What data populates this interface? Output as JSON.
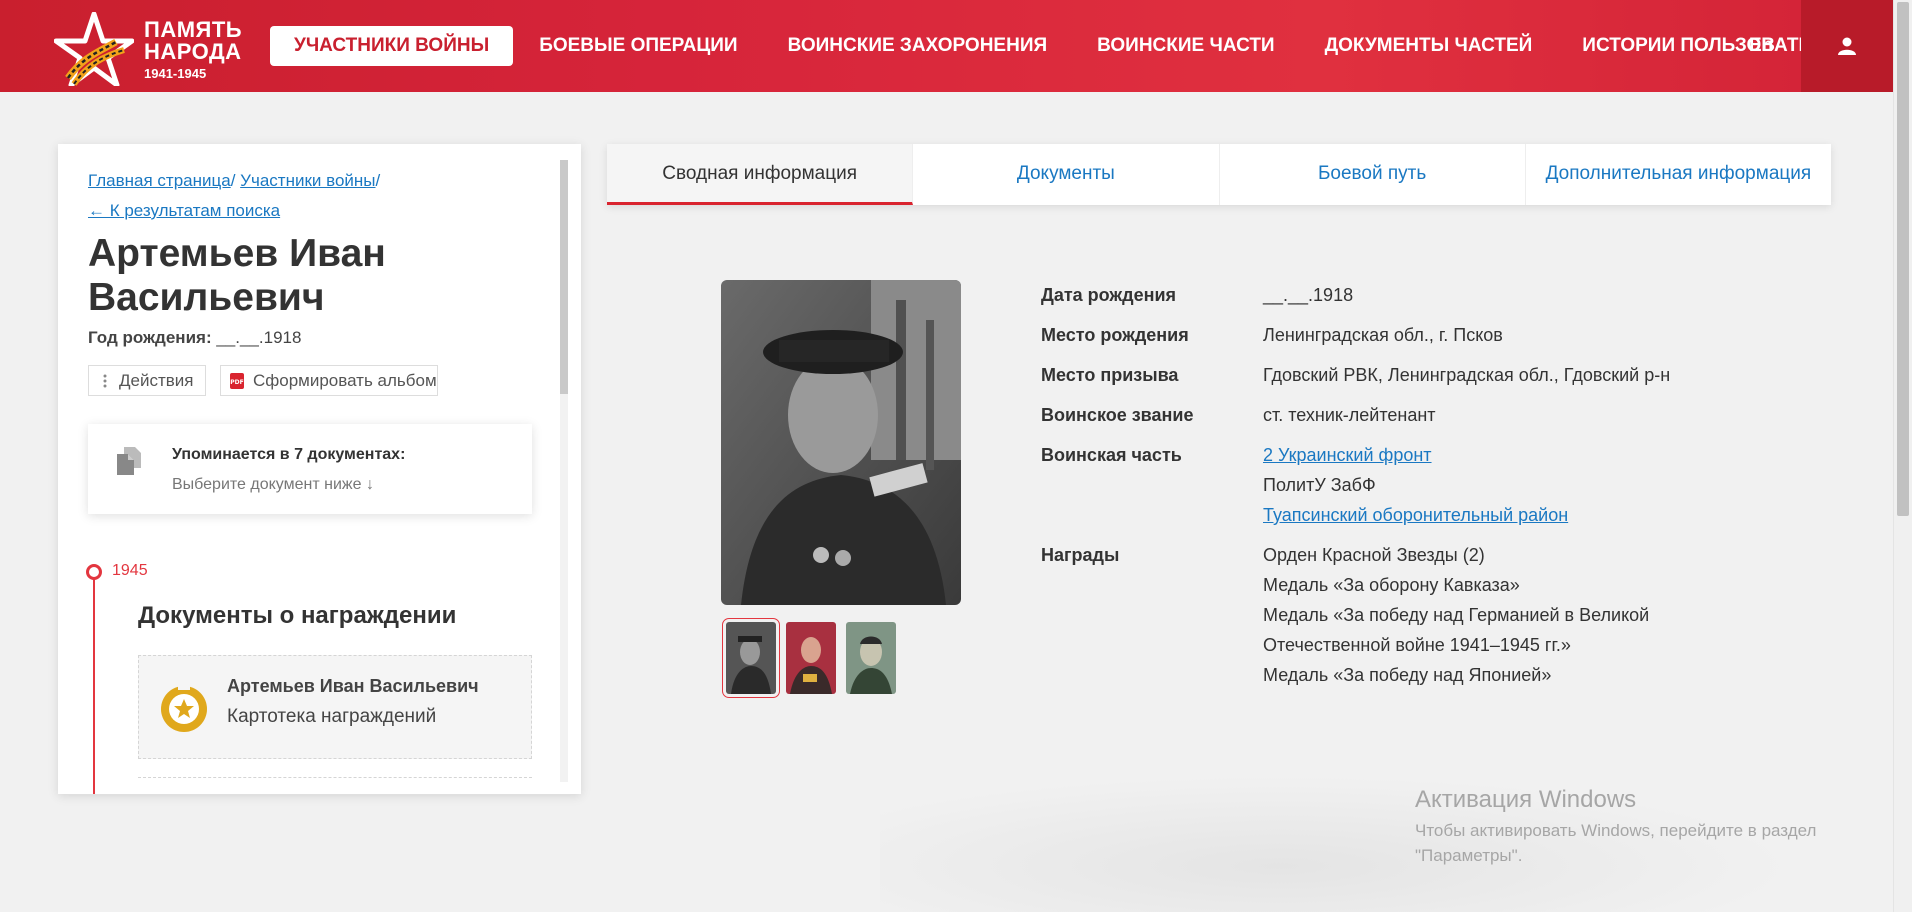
{
  "header": {
    "logo": {
      "line1": "ПАМЯТЬ",
      "line2": "НАРОДА",
      "years": "1941-1945"
    },
    "nav": [
      {
        "label": "УЧАСТНИКИ ВОЙНЫ",
        "active": true
      },
      {
        "label": "БОЕВЫЕ ОПЕРАЦИИ"
      },
      {
        "label": "ВОИНСКИЕ ЗАХОРОНЕНИЯ"
      },
      {
        "label": "ВОИНСКИЕ ЧАСТИ"
      },
      {
        "label": "ДОКУМЕНТЫ ЧАСТЕЙ"
      },
      {
        "label": "ИСТОРИИ ПОЛЬЗОВАТЕЛЕЙ"
      }
    ],
    "lang": "En",
    "user_icon": "user-icon",
    "colors": {
      "brand_red": "#d6243a",
      "link_blue": "#1a78c2"
    }
  },
  "sidebar": {
    "breadcrumb": {
      "home": "Главная страница",
      "participants": "Участники войны",
      "sep": "/",
      "back": "← К результатам поиска"
    },
    "name": "Артемьев Иван Васильевич",
    "birth_label": "Год рождения:",
    "birth_value": "__.__.1918",
    "actions_label": "Действия",
    "album_label": "Сформировать альбом",
    "mention_title": "Упоминается в 7 документах:",
    "mention_sub": "Выберите документ ниже",
    "mention_arrow": "↓",
    "timeline_year": "1945",
    "docs_heading": "Документы о награждении",
    "award_card": {
      "name": "Артемьев Иван Васильевич",
      "type": "Картотека награждений"
    }
  },
  "tabs": [
    {
      "label": "Сводная информация",
      "active": true
    },
    {
      "label": "Документы"
    },
    {
      "label": "Боевой путь"
    },
    {
      "label": "Дополнительная информация"
    }
  ],
  "info": {
    "birth_date": {
      "label": "Дата рождения",
      "value": "__.__.1918"
    },
    "birth_place": {
      "label": "Место рождения",
      "value": "Ленинградская обл., г. Псков"
    },
    "draft_place": {
      "label": "Место призыва",
      "value": "Гдовский РВК, Ленинградская обл., Гдовский р-н"
    },
    "rank": {
      "label": "Воинское звание",
      "value": "ст. техник-лейтенант"
    },
    "unit": {
      "label": "Воинская часть",
      "values": [
        "2 Украинский фронт",
        "ПолитУ ЗабФ",
        "Туапсинский оборонительный район"
      ]
    },
    "awards": {
      "label": "Награды",
      "values": [
        "Орден Красной Звезды (2)",
        "Медаль «За оборону Кавказа»",
        "Медаль «За победу над Германией в Великой",
        "Отечественной войне 1941–1945 гг.»",
        "Медаль «За победу над Японией»"
      ]
    }
  },
  "watermark": {
    "title": "Активация Windows",
    "text": "Чтобы активировать Windows, перейдите в раздел \"Параметры\"."
  }
}
